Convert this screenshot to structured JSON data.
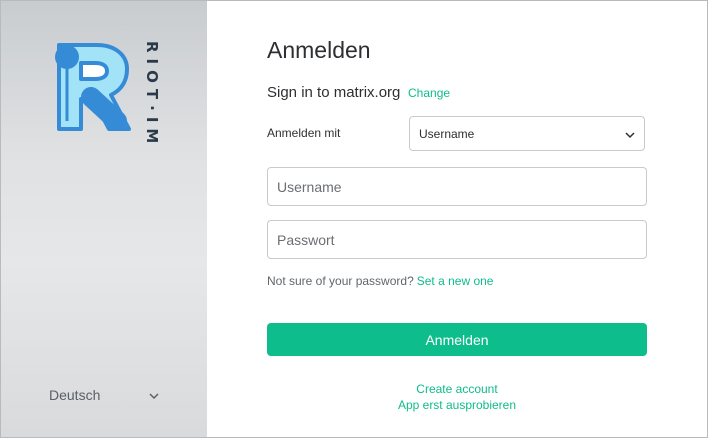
{
  "sidebar": {
    "brand_text": "RIOT·IM",
    "language": "Deutsch"
  },
  "login": {
    "title": "Anmelden",
    "server_text": "Sign in to matrix.org",
    "change_link": "Change",
    "login_with_label": "Anmelden mit",
    "login_with_value": "Username",
    "username_placeholder": "Username",
    "password_placeholder": "Passwort",
    "forgot_text": "Not sure of your password?",
    "forgot_link": "Set a new one",
    "submit_label": "Anmelden",
    "create_account": "Create account",
    "try_app": "App erst ausprobieren"
  },
  "colors": {
    "accent": "#0dbd8b",
    "logo_blue": "#368bd6",
    "logo_light": "#a3e3f7"
  }
}
